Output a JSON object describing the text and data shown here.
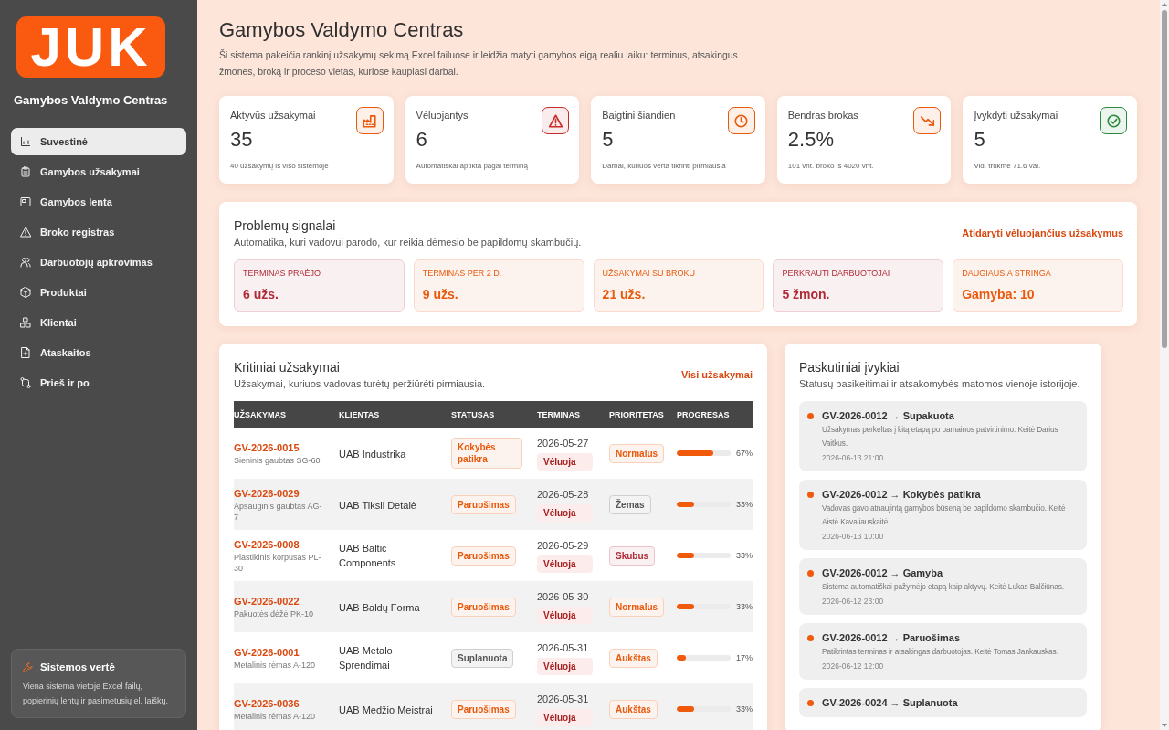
{
  "sidebar": {
    "logo": "JUK",
    "title": "Gamybos Valdymo Centras",
    "items": [
      {
        "label": "Suvestinė",
        "selected": true
      },
      {
        "label": "Gamybos užsakymai",
        "selected": false
      },
      {
        "label": "Gamybos lenta",
        "selected": false
      },
      {
        "label": "Broko registras",
        "selected": false
      },
      {
        "label": "Darbuotojų apkrovimas",
        "selected": false
      },
      {
        "label": "Produktai",
        "selected": false
      },
      {
        "label": "Klientai",
        "selected": false
      },
      {
        "label": "Ataskaitos",
        "selected": false
      },
      {
        "label": "Prieš ir po",
        "selected": false
      }
    ],
    "info_card": {
      "title": "Sistemos vertė",
      "text": "Viena sistema vietoje Excel failų, popierinių lentų ir pasimetusių el. laiškų."
    }
  },
  "header": {
    "title": "Gamybos Valdymo Centras",
    "description": "Ši sistema pakeičia rankinį užsakymų sekimą Excel failuose ir leidžia matyti gamybos eigą realiu laiku: terminus, atsakingus žmones, broką ir proceso vietas, kuriose kaupiasi darbai."
  },
  "kpis": [
    {
      "label": "Aktyvūs užsakymai",
      "value": "35",
      "note": "40 užsakymų iš viso sistemoje",
      "color": "#e8590c"
    },
    {
      "label": "Vėluojantys",
      "value": "6",
      "note": "Automatiškai aptikta pagal terminą",
      "color": "#c92a2a"
    },
    {
      "label": "Baigtini šiandien",
      "value": "5",
      "note": "Darbai, kuriuos verta tikrinti pirmiausia",
      "color": "#e8590c"
    },
    {
      "label": "Bendras brokas",
      "value": "2.5%",
      "note": "101 vnt. broko iš 4020 vnt.",
      "color": "#e8590c"
    },
    {
      "label": "Įvykdyti užsakymai",
      "value": "5",
      "note": "Vid. trukmė 71.6 val.",
      "color": "#2b8a3e"
    }
  ],
  "signals": {
    "title": "Problemų signalai",
    "subtitle": "Automatika, kuri vadovui parodo, kur reikia dėmesio be papildomų skambučių.",
    "link": "Atidaryti vėluojančius užsakymus",
    "tiles": [
      {
        "label": "TERMINAS PRAĖJO",
        "value": "6 užs.",
        "color": "#b02a37"
      },
      {
        "label": "TERMINAS PER 2 D.",
        "value": "9 užs.",
        "color": "#e8590c"
      },
      {
        "label": "UŽSAKYMAI SU BROKU",
        "value": "21 užs.",
        "color": "#e8590c"
      },
      {
        "label": "PERKRAUTI DARBUOTOJAI",
        "value": "5 žmon.",
        "color": "#b02a37"
      },
      {
        "label": "DAUGIAUSIA STRINGA",
        "value": "Gamyba: 10",
        "color": "#e8590c"
      }
    ]
  },
  "critical_orders": {
    "title": "Kritiniai užsakymai",
    "subtitle": "Užsakymai, kuriuos vadovas turėtų peržiūrėti pirmiausia.",
    "link": "Visi užsakymai",
    "table": {
      "columns": [
        "UŽSAKYMAS",
        "KLIENTAS",
        "STATUSAS",
        "TERMINAS",
        "PRIORITETAS",
        "PROGRESAS"
      ],
      "rows": [
        {
          "order": "GV-2026-0015",
          "product": "Sieninis gaubtas SG-60",
          "client": "UAB Industrika",
          "status": {
            "text": "Kokybės patikra",
            "color": "#e8590c"
          },
          "deadline": "2026-05-27",
          "deadline_flag": "Vėluoja",
          "priority": {
            "text": "Normalus",
            "color": "#e8590c"
          },
          "level": 0.67,
          "progress": "67%"
        },
        {
          "order": "GV-2026-0029",
          "product": "Apsauginis gaubtas AG-7",
          "client": "UAB Tiksli Detalė",
          "status": {
            "text": "Paruošimas",
            "color": "#e8590c"
          },
          "deadline": "2026-05-28",
          "deadline_flag": "Vėluoja",
          "priority": {
            "text": "Žemas",
            "color": "#555555"
          },
          "level": 0.33,
          "progress": "33%"
        },
        {
          "order": "GV-2026-0008",
          "product": "Plastikinis korpusas PL-30",
          "client": "UAB Baltic Components",
          "status": {
            "text": "Paruošimas",
            "color": "#e8590c"
          },
          "deadline": "2026-05-29",
          "deadline_flag": "Vėluoja",
          "priority": {
            "text": "Skubus",
            "color": "#b02a37"
          },
          "level": 0.33,
          "progress": "33%"
        },
        {
          "order": "GV-2026-0022",
          "product": "Pakuotės dėžė PK-10",
          "client": "UAB Baldų Forma",
          "status": {
            "text": "Paruošimas",
            "color": "#e8590c"
          },
          "deadline": "2026-05-30",
          "deadline_flag": "Vėluoja",
          "priority": {
            "text": "Normalus",
            "color": "#e8590c"
          },
          "level": 0.33,
          "progress": "33%"
        },
        {
          "order": "GV-2026-0001",
          "product": "Metalinis rėmas A-120",
          "client": "UAB Metalo Sprendimai",
          "status": {
            "text": "Suplanuota",
            "color": "#555555"
          },
          "deadline": "2026-05-31",
          "deadline_flag": "Vėluoja",
          "priority": {
            "text": "Aukštas",
            "color": "#e8590c"
          },
          "level": 0.17,
          "progress": "17%"
        },
        {
          "order": "GV-2026-0036",
          "product": "Metalinis rėmas A-120",
          "client": "UAB Medžio Meistrai",
          "status": {
            "text": "Paruošimas",
            "color": "#e8590c"
          },
          "deadline": "2026-05-31",
          "deadline_flag": "Vėluoja",
          "priority": {
            "text": "Aukštas",
            "color": "#e8590c"
          },
          "level": 0.33,
          "progress": "33%"
        }
      ]
    }
  },
  "events": {
    "title": "Paskutiniai įvykiai",
    "subtitle": "Statusų pasikeitimai ir atsakomybės matomos vienoje istorijoje.",
    "items": [
      {
        "title": "GV-2026-0012 → Supakuota",
        "text": "Užsakymas perkeltas į kitą etapą po pamainos patvirtinimo. Keitė Darius Vaitkus.",
        "time": "2026-06-13 21:00"
      },
      {
        "title": "GV-2026-0012 → Kokybės patikra",
        "text": "Vadovas gavo atnaujintą gamybos būseną be papildomo skambučio. Keitė Aistė Kavaliauskaitė.",
        "time": "2026-06-13 10:00"
      },
      {
        "title": "GV-2026-0012 → Gamyba",
        "text": "Sistema automatiškai pažymėjo etapą kaip aktyvų. Keitė Lukas Balčiūnas.",
        "time": "2026-06-12 23:00"
      },
      {
        "title": "GV-2026-0012 → Paruošimas",
        "text": "Patikrintas terminas ir atsakingas darbuotojas. Keitė Tomas Jankauskas.",
        "time": "2026-06-12 12:00"
      },
      {
        "title": "GV-2026-0024 → Suplanuota"
      }
    ]
  }
}
